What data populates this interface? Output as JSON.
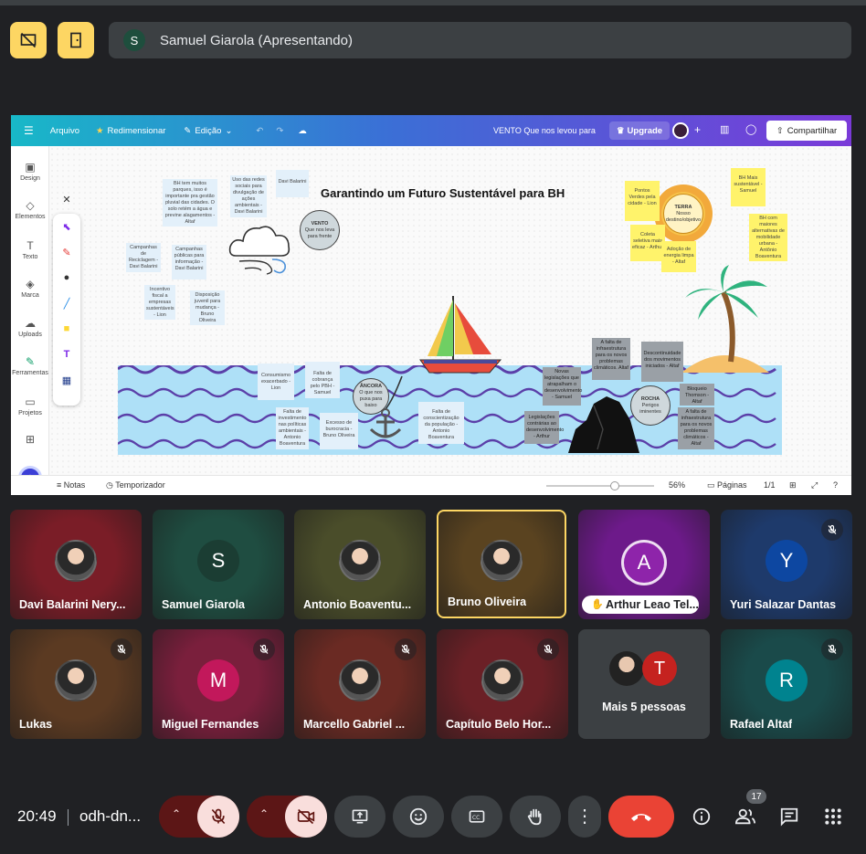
{
  "presenter_bar": {
    "avatar_letter": "S",
    "text": "Samuel Giarola (Apresentando)"
  },
  "canva": {
    "menu": [
      "Arquivo",
      "Redimensionar",
      "Edição"
    ],
    "doc_name": "VENTO Que nos levou para",
    "upgrade": "Upgrade",
    "share": "Compartilhar",
    "left_rail": [
      "Design",
      "Elementos",
      "Texto",
      "Marca",
      "Uploads",
      "Ferramentas",
      "Projetos"
    ],
    "title": "Garantindo um Futuro Sustentável para BH",
    "notes": [
      "BH tem muitos parques, isso é importante pra gestão pluvial das cidades. O solo retém a água e previne alagamentos - Altaf",
      "Uso das redes sociais para divulgação de ações ambientais - Davi Balarini",
      "Davi Balarini",
      "Campanhas de Reciclagem - Davi Balarini",
      "Campanhas públicas para informação - Davi Balarini",
      "Incentivo fiscal a empresas sustentáveis - Lion",
      "Disposição juvenil para mudança - Bruno Oliveira",
      "Pontos Verdes pela cidade - Lion",
      "Coleta seletiva mais eficaz - Arthur",
      "Adoção de energia limpa - Altaf",
      "BH Mais sustentável - Samuel",
      "BH com maiores alternativas de mobilidade urbana - Antônio Boaventura",
      "Consumismo exacerbado - Lion",
      "Falta de cobrança pelo PBH - Samuel",
      "Falta de investimento nas políticas ambientais - Antonio Boaventura",
      "Excesso de burocracia - Bruno Oliveira",
      "Falta de conscientização da população - Antonio Boaventura",
      "Novas legislações que atrapalham o desenvolvimento - Samuel",
      "Legislações contrárias ao desenvolvimento - Arthur",
      "A falta de infraestrutura para os novos problemas climáticos. Altaf",
      "Descontinuidade dos movimentos iniciados - Altaf",
      "Bloqueio Thomson - Altaf",
      "A falta de infraestrutura para os novos problemas climáticos - Altaf"
    ],
    "circles": {
      "vento_title": "VENTO",
      "vento_text": "Que nos leva para frente",
      "ancora_title": "ÂNCORA",
      "ancora_text": "O que nos puxa para baixo",
      "rocha_title": "ROCHA",
      "rocha_text": "Perigos iminentes",
      "terra_title": "TERRA",
      "terra_text": "Nosso destino/objetivo"
    },
    "bottom": {
      "notas": "Notas",
      "timer": "Temporizador",
      "zoom": "56%",
      "pages_label": "Páginas",
      "pages": "1/1"
    }
  },
  "participants": [
    {
      "name": "Davi Balarini Nery...",
      "color": "#7a1d27",
      "avatar": "img",
      "muted": false
    },
    {
      "name": "Samuel Giarola",
      "color": "#1f4d41",
      "avatar": "S",
      "avatar_color": "#1b3d33",
      "muted": false
    },
    {
      "name": "Antonio Boaventu...",
      "color": "#4a4d2a",
      "avatar": "img",
      "muted": false
    },
    {
      "name": "Bruno Oliveira",
      "color": "#5a4320",
      "avatar": "img",
      "muted": false,
      "active": true
    },
    {
      "name": "Arthur Leao Tel...",
      "color": "#6d1a8a",
      "avatar": "A",
      "avatar_color": "#8e24aa",
      "muted": false,
      "pill": true
    },
    {
      "name": "Yuri Salazar Dantas",
      "color": "#1e3a6b",
      "avatar": "Y",
      "avatar_color": "#0d47a1",
      "muted": true
    },
    {
      "name": "Lukas",
      "color": "#5b3a22",
      "avatar": "img",
      "muted": true
    },
    {
      "name": "Miguel Fernandes",
      "color": "#7a1f3c",
      "avatar": "M",
      "avatar_color": "#c2185b",
      "muted": true
    },
    {
      "name": "Marcello Gabriel ...",
      "color": "#6a2a23",
      "avatar": "img",
      "muted": true
    },
    {
      "name": "Capítulo Belo Hor...",
      "color": "#6b2026",
      "avatar": "img",
      "muted": true
    },
    {
      "name": "Mais 5 pessoas",
      "color": "#3c4043",
      "avatar": "group",
      "muted": false
    },
    {
      "name": "Rafael Altaf",
      "color": "#1a4a4a",
      "avatar": "R",
      "avatar_color": "#00838f",
      "muted": true
    }
  ],
  "more_people": {
    "second_letter": "T"
  },
  "controls": {
    "time": "20:49",
    "meeting_id": "odh-dn...",
    "participants_count": "17"
  },
  "colors": {
    "accent_yellow": "#fdd663",
    "hangup_red": "#ea4335",
    "muted_red": "#f9dedc",
    "bg": "#202124"
  }
}
